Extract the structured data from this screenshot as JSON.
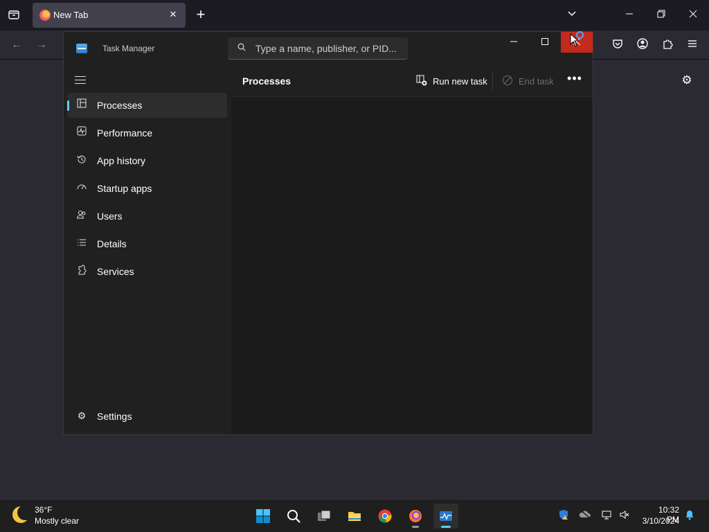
{
  "browser": {
    "tab_title": "New Tab",
    "tab_close": "✕",
    "new_tab": "+"
  },
  "taskmanager": {
    "title": "Task Manager",
    "search_placeholder": "Type a name, publisher, or PID...",
    "nav": [
      {
        "label": "Processes",
        "icon": "processes-icon"
      },
      {
        "label": "Performance",
        "icon": "performance-icon"
      },
      {
        "label": "App history",
        "icon": "history-icon"
      },
      {
        "label": "Startup apps",
        "icon": "startup-icon"
      },
      {
        "label": "Users",
        "icon": "users-icon"
      },
      {
        "label": "Details",
        "icon": "details-icon"
      },
      {
        "label": "Services",
        "icon": "services-icon"
      }
    ],
    "settings_label": "Settings",
    "page_title": "Processes",
    "run_new_task": "Run new task",
    "end_task": "End task"
  },
  "taskbar": {
    "weather_temp": "36°F",
    "weather_desc": "Mostly clear",
    "clock_time": "10:32 PM",
    "clock_date": "3/10/2024"
  },
  "colors": {
    "accent": "#60cdff",
    "close_red": "#c42b1c",
    "window_bg": "#202020"
  }
}
